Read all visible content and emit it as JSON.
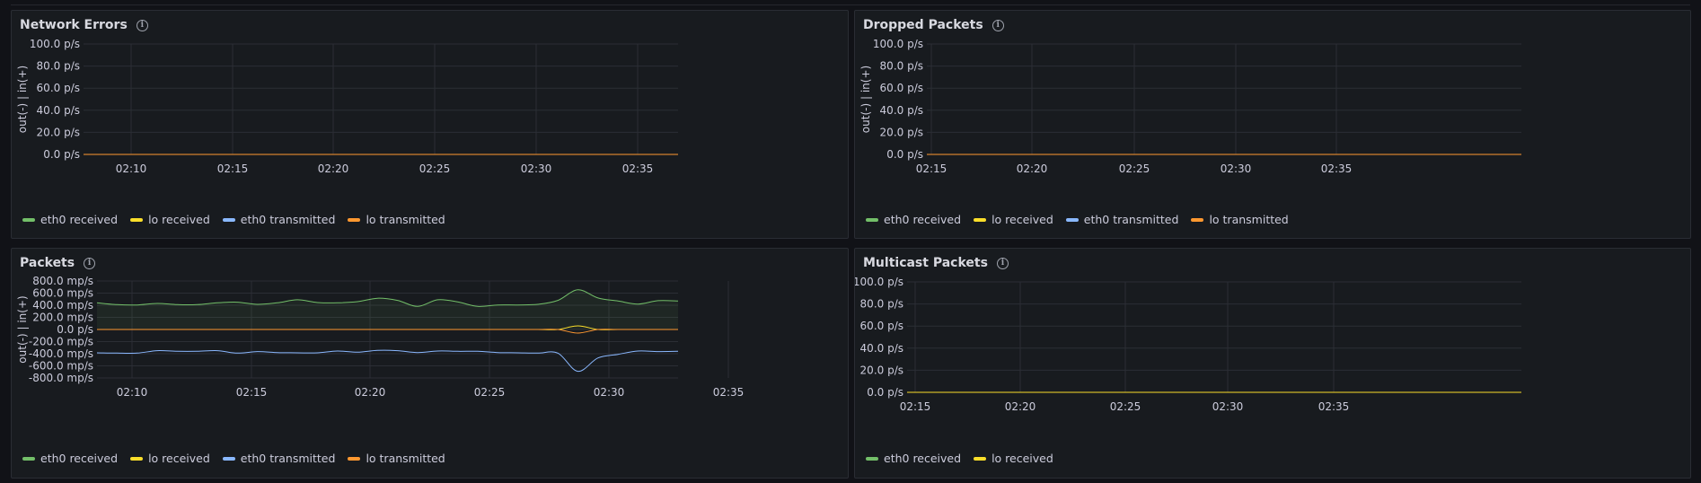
{
  "colors": {
    "eth0_received": "#73bf69",
    "lo_received": "#fade2a",
    "eth0_transmitted": "#8ab8ff",
    "lo_transmitted": "#ff9830"
  },
  "chart_data": [
    {
      "id": "network-errors",
      "type": "line",
      "title": "Network Errors",
      "ylabel": "out(-) | in(+)",
      "xlabel": "",
      "x_ticks": [
        "02:10",
        "02:15",
        "02:20",
        "02:25",
        "02:30",
        "02:35"
      ],
      "y_ticks": [
        "100.0 p/s",
        "80.0 p/s",
        "60.0 p/s",
        "40.0 p/s",
        "20.0 p/s",
        "0.0 p/s"
      ],
      "ylim": [
        0,
        100
      ],
      "grid": true,
      "legend_placement": "bottom-left",
      "series": [
        {
          "name": "eth0 received",
          "color_key": "eth0_received",
          "values": [
            0,
            0
          ]
        },
        {
          "name": "lo received",
          "color_key": "lo_received",
          "values": [
            0,
            0
          ]
        },
        {
          "name": "eth0 transmitted",
          "color_key": "eth0_transmitted",
          "values": [
            0,
            0
          ]
        },
        {
          "name": "lo transmitted",
          "color_key": "lo_transmitted",
          "values": [
            0,
            0
          ]
        }
      ]
    },
    {
      "id": "dropped-packets",
      "type": "line",
      "title": "Dropped Packets",
      "ylabel": "out(-) | in(+)",
      "xlabel": "",
      "x_ticks": [
        "02:10",
        "02:15",
        "02:20",
        "02:25",
        "02:30",
        "02:35"
      ],
      "y_ticks": [
        "100.0 p/s",
        "80.0 p/s",
        "60.0 p/s",
        "40.0 p/s",
        "20.0 p/s",
        "0.0 p/s"
      ],
      "ylim": [
        0,
        100
      ],
      "grid": true,
      "legend_placement": "bottom-left",
      "series": [
        {
          "name": "eth0 received",
          "color_key": "eth0_received",
          "values": [
            0,
            0
          ]
        },
        {
          "name": "lo received",
          "color_key": "lo_received",
          "values": [
            0,
            0
          ]
        },
        {
          "name": "eth0 transmitted",
          "color_key": "eth0_transmitted",
          "values": [
            0,
            0
          ]
        },
        {
          "name": "lo transmitted",
          "color_key": "lo_transmitted",
          "values": [
            0,
            0
          ]
        }
      ]
    },
    {
      "id": "packets",
      "type": "line",
      "title": "Packets",
      "ylabel": "out(-) | in(+)",
      "xlabel": "",
      "x_ticks": [
        "02:10",
        "02:15",
        "02:20",
        "02:25",
        "02:30",
        "02:35"
      ],
      "y_ticks": [
        "800.0 mp/s",
        "600.0 mp/s",
        "400.0 mp/s",
        "200.0 mp/s",
        "0.0 p/s",
        "-200.0 mp/s",
        "-400.0 mp/s",
        "-600.0 mp/s",
        "-800.0 mp/s"
      ],
      "ylim": [
        -800,
        800
      ],
      "grid": true,
      "legend_placement": "bottom-left",
      "series": [
        {
          "name": "eth0 received",
          "color_key": "eth0_received",
          "fill": true,
          "values": [
            440,
            410,
            405,
            430,
            410,
            410,
            440,
            450,
            415,
            440,
            490,
            445,
            440,
            460,
            515,
            480,
            380,
            490,
            455,
            380,
            405,
            405,
            415,
            480,
            655,
            520,
            470,
            420,
            475,
            470
          ]
        },
        {
          "name": "lo received",
          "color_key": "lo_received",
          "values": [
            0,
            0,
            0,
            0,
            0,
            0,
            0,
            0,
            0,
            0,
            0,
            0,
            0,
            0,
            0,
            0,
            0,
            0,
            0,
            0,
            0,
            0,
            0,
            0,
            60,
            0,
            0,
            0,
            0,
            0
          ]
        },
        {
          "name": "eth0 transmitted",
          "color_key": "eth0_transmitted",
          "values": [
            -385,
            -390,
            -390,
            -350,
            -360,
            -360,
            -350,
            -390,
            -365,
            -380,
            -385,
            -385,
            -355,
            -375,
            -345,
            -350,
            -380,
            -355,
            -360,
            -360,
            -380,
            -385,
            -390,
            -390,
            -690,
            -470,
            -410,
            -355,
            -365,
            -360
          ]
        },
        {
          "name": "lo transmitted",
          "color_key": "lo_transmitted",
          "values": [
            0,
            0,
            0,
            0,
            0,
            0,
            0,
            0,
            0,
            0,
            0,
            0,
            0,
            0,
            0,
            0,
            0,
            0,
            0,
            0,
            0,
            0,
            0,
            0,
            -60,
            0,
            0,
            0,
            0,
            0
          ]
        }
      ]
    },
    {
      "id": "multicast-packets",
      "type": "line",
      "title": "Multicast Packets",
      "ylabel": "",
      "xlabel": "",
      "x_ticks": [
        "02:10",
        "02:15",
        "02:20",
        "02:25",
        "02:30",
        "02:35"
      ],
      "y_ticks": [
        "100.0 p/s",
        "80.0 p/s",
        "60.0 p/s",
        "40.0 p/s",
        "20.0 p/s",
        "0.0 p/s"
      ],
      "ylim": [
        0,
        100
      ],
      "grid": true,
      "legend_placement": "bottom-left",
      "series": [
        {
          "name": "eth0 received",
          "color_key": "eth0_received",
          "values": [
            0,
            0
          ]
        },
        {
          "name": "lo received",
          "color_key": "lo_received",
          "values": [
            0,
            0
          ]
        }
      ]
    }
  ]
}
